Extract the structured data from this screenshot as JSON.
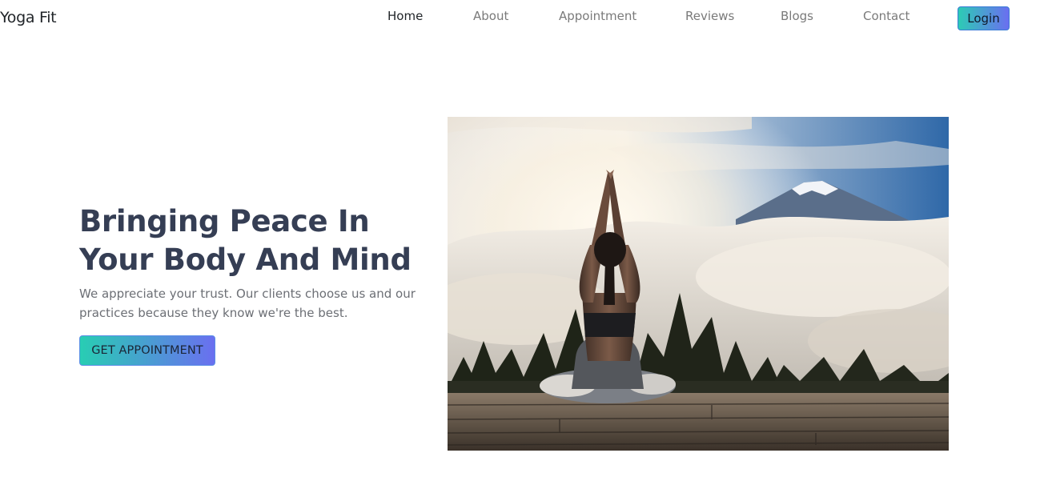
{
  "nav": {
    "brand": "Yoga Fit",
    "links": [
      {
        "label": "Home",
        "active": true
      },
      {
        "label": "About",
        "active": false
      },
      {
        "label": "Appointment",
        "active": false
      },
      {
        "label": "Reviews",
        "active": false
      },
      {
        "label": "Blogs",
        "active": false
      },
      {
        "label": "Contact",
        "active": false
      }
    ],
    "login_label": "Login"
  },
  "hero": {
    "title": "Bringing Peace In Your Body And Mind",
    "description": "We appreciate your trust. Our clients choose us and our practices because they know we're the best.",
    "cta_label": "GET APPOINTMENT",
    "image_subject": "woman meditating in lotus pose on wooden deck above clouds facing snow-capped mountain"
  },
  "colors": {
    "gradient_start": "#2dcbb5",
    "gradient_end": "#6a6ff0",
    "heading": "#353e54",
    "body_text": "#6c6f75",
    "nav_inactive": "#7a7a7a",
    "nav_active": "#212529"
  }
}
